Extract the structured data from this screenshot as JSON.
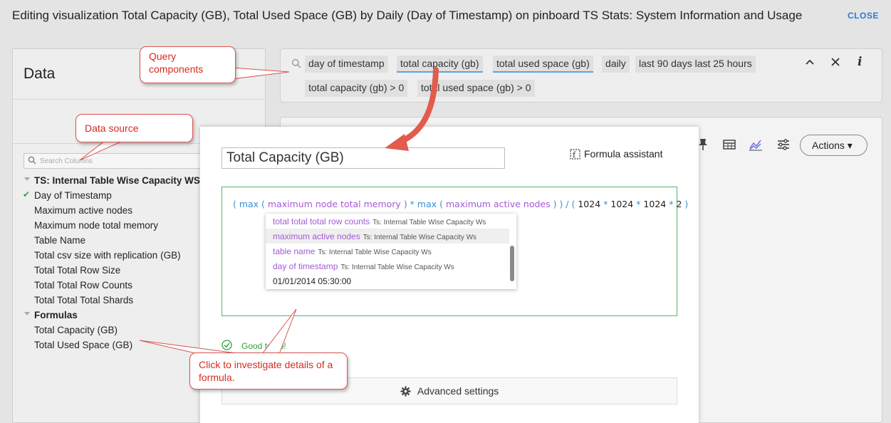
{
  "header": {
    "title": "Editing visualization Total Capacity (GB), Total Used Space (GB) by Daily (Day of Timestamp) on pinboard TS Stats: System Information and Usage",
    "close_label": "CLOSE"
  },
  "data_panel": {
    "title": "Data",
    "search_placeholder": "Search Columns",
    "source_group": "TS: Internal Table Wise Capacity WS",
    "columns": [
      "Day of Timestamp",
      "Maximum active nodes",
      "Maximum node total memory",
      "Table Name",
      "Total csv size with replication (GB)",
      "Total Total Row Size",
      "Total Total Row Counts",
      "Total Total Total Shards"
    ],
    "formulas_group": "Formulas",
    "formulas": [
      "Total Capacity (GB)",
      "Total Used Space (GB)"
    ]
  },
  "search_bar": {
    "tokens_row1": [
      "day of timestamp",
      "total capacity (gb)",
      "total used space (gb)",
      "daily",
      "last 90 days last 25 hours"
    ],
    "tokens_row2": [
      "total capacity (gb) > 0",
      "total used space (gb) > 0"
    ]
  },
  "viz_toolbar": {
    "actions_label": "Actions ▾"
  },
  "formula_editor": {
    "name": "Total Capacity (GB)",
    "assistant_label": "Formula assistant",
    "expression": {
      "p1": "( max (",
      "c1": "maximum node total memory",
      "p2": ") * max (",
      "c2": "maximum active nodes",
      "p3": ") ) / (",
      "n1": "1024",
      "o1": "*",
      "n2": "1024",
      "o2": "*",
      "n3": "1024",
      "o3": "*",
      "n4": "2",
      "p4": ")"
    },
    "suggestions": [
      {
        "col": "total total total row counts",
        "src": "Ts: Internal Table Wise Capacity Ws"
      },
      {
        "col": "maximum active nodes",
        "src": "Ts: Internal Table Wise Capacity Ws"
      },
      {
        "col": "table name",
        "src": "Ts: Internal Table Wise Capacity Ws"
      },
      {
        "col": "day of timestamp",
        "src": "Ts: Internal Table Wise Capacity Ws"
      }
    ],
    "suggestion_value": "01/01/2014 05:30:00",
    "status": "Good to go!",
    "advanced_label": "Advanced settings"
  },
  "callouts": {
    "query": "Query components",
    "source": "Data source",
    "formula": "Click to investigate details of a formula."
  },
  "colors": {
    "accent_blue": "#2a7ad2",
    "column_purple": "#a35ad6",
    "ok_green": "#29a23c",
    "callout_red": "#d62b1f"
  }
}
